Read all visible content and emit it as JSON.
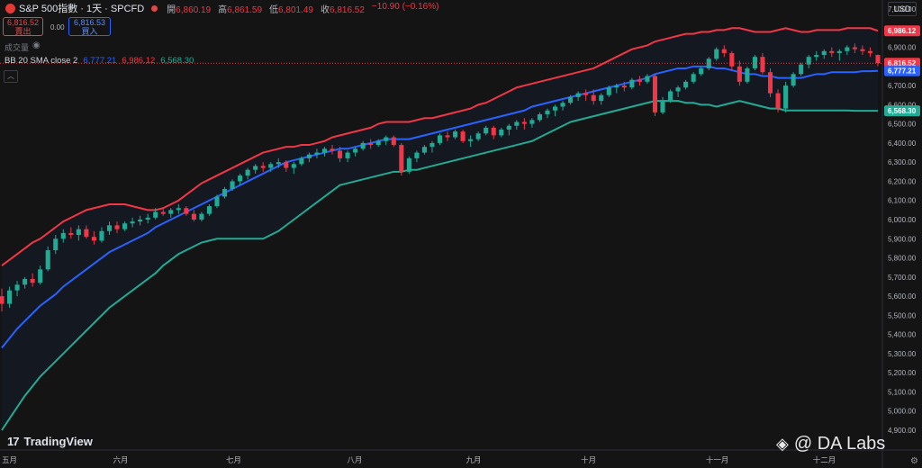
{
  "header": {
    "symbol_title": "S&P 500指數 · 1天 · SPCFD",
    "ohlc": [
      {
        "k": "開",
        "v": "6,860.19"
      },
      {
        "k": "高",
        "v": "6,861.59"
      },
      {
        "k": "低",
        "v": "6,801.49"
      },
      {
        "k": "收",
        "v": "6,816.52"
      }
    ],
    "change": "−10.90 (−0.16%)",
    "currency": "USD"
  },
  "trade": {
    "sell_price": "6,816.52",
    "sell_label": "賣出",
    "spread": "0.00",
    "buy_price": "6,816.53",
    "buy_label": "買入"
  },
  "indicators": {
    "volume_label": "成交量",
    "bb_name": "BB 20 SMA close 2",
    "bb_basis": "6,777.21",
    "bb_upper": "6,986.12",
    "bb_lower": "6,568.30"
  },
  "branding": {
    "tv_logo": "TradingView",
    "watermark": "@ DA Labs"
  },
  "colors": {
    "up": "#22ab94",
    "down": "#f23645",
    "basis": "#2962ff",
    "upper": "#f23645",
    "lower": "#22ab94",
    "price_tag": "#f23645"
  },
  "chart_data": {
    "type": "candlestick",
    "ylim": [
      4900,
      7100
    ],
    "y_ticks": [
      4900,
      5000,
      5100,
      5200,
      5300,
      5400,
      5500,
      5600,
      5700,
      5800,
      5900,
      6000,
      6100,
      6200,
      6300,
      6400,
      6500,
      6600,
      6700,
      6800,
      6900,
      7000,
      7100
    ],
    "y_tick_labels": [
      "4,900.00",
      "5,000.00",
      "5,100.00",
      "5,200.00",
      "5,300.00",
      "5,400.00",
      "5,500.00",
      "5,600.00",
      "5,700.00",
      "5,800.00",
      "5,900.00",
      "6,000.00",
      "6,100.00",
      "6,200.00",
      "6,300.00",
      "6,400.00",
      "6,500.00",
      "6,600.00",
      "6,700.00",
      "6,800.00",
      "6,900.00",
      "7,000.00",
      "7,100.00"
    ],
    "x_labels": [
      {
        "label": "五月",
        "pos": 0.0
      },
      {
        "label": "六月",
        "pos": 0.1357
      },
      {
        "label": "七月",
        "pos": 0.2647
      },
      {
        "label": "八月",
        "pos": 0.4027
      },
      {
        "label": "九月",
        "pos": 0.5385
      },
      {
        "label": "十月",
        "pos": 0.6697
      },
      {
        "label": "十一月",
        "pos": 0.8167
      },
      {
        "label": "十二月",
        "pos": 0.9389
      }
    ],
    "candles": [
      [
        5600,
        5640,
        5520,
        5560
      ],
      [
        5560,
        5650,
        5540,
        5630
      ],
      [
        5630,
        5680,
        5600,
        5660
      ],
      [
        5660,
        5700,
        5640,
        5690
      ],
      [
        5690,
        5720,
        5650,
        5670
      ],
      [
        5670,
        5760,
        5660,
        5740
      ],
      [
        5740,
        5860,
        5730,
        5840
      ],
      [
        5840,
        5920,
        5820,
        5900
      ],
      [
        5900,
        5950,
        5880,
        5930
      ],
      [
        5930,
        5960,
        5900,
        5920
      ],
      [
        5920,
        5970,
        5890,
        5950
      ],
      [
        5950,
        5970,
        5900,
        5910
      ],
      [
        5910,
        5940,
        5870,
        5890
      ],
      [
        5890,
        5960,
        5880,
        5940
      ],
      [
        5940,
        5990,
        5920,
        5970
      ],
      [
        5970,
        5990,
        5930,
        5950
      ],
      [
        5950,
        5990,
        5940,
        5980
      ],
      [
        5980,
        6010,
        5960,
        5990
      ],
      [
        5990,
        6020,
        5970,
        6000
      ],
      [
        6000,
        6030,
        5980,
        6010
      ],
      [
        6010,
        6060,
        6000,
        6040
      ],
      [
        6040,
        6060,
        6020,
        6030
      ],
      [
        6030,
        6060,
        6010,
        6050
      ],
      [
        6050,
        6080,
        6030,
        6060
      ],
      [
        6060,
        6070,
        6020,
        6030
      ],
      [
        6030,
        6050,
        5990,
        6000
      ],
      [
        6000,
        6040,
        5990,
        6030
      ],
      [
        6030,
        6080,
        6020,
        6070
      ],
      [
        6070,
        6130,
        6060,
        6120
      ],
      [
        6120,
        6170,
        6110,
        6160
      ],
      [
        6160,
        6210,
        6150,
        6200
      ],
      [
        6200,
        6240,
        6180,
        6230
      ],
      [
        6230,
        6270,
        6210,
        6260
      ],
      [
        6260,
        6290,
        6240,
        6280
      ],
      [
        6280,
        6300,
        6250,
        6270
      ],
      [
        6270,
        6300,
        6250,
        6290
      ],
      [
        6290,
        6320,
        6270,
        6300
      ],
      [
        6300,
        6310,
        6250,
        6270
      ],
      [
        6270,
        6300,
        6240,
        6290
      ],
      [
        6290,
        6330,
        6280,
        6320
      ],
      [
        6320,
        6350,
        6300,
        6340
      ],
      [
        6340,
        6370,
        6320,
        6350
      ],
      [
        6350,
        6380,
        6330,
        6370
      ],
      [
        6370,
        6390,
        6340,
        6360
      ],
      [
        6360,
        6380,
        6300,
        6320
      ],
      [
        6320,
        6360,
        6300,
        6350
      ],
      [
        6350,
        6380,
        6330,
        6370
      ],
      [
        6370,
        6410,
        6360,
        6400
      ],
      [
        6400,
        6420,
        6370,
        6390
      ],
      [
        6390,
        6420,
        6380,
        6410
      ],
      [
        6410,
        6440,
        6390,
        6430
      ],
      [
        6430,
        6440,
        6380,
        6390
      ],
      [
        6390,
        6400,
        6230,
        6250
      ],
      [
        6250,
        6330,
        6240,
        6320
      ],
      [
        6320,
        6360,
        6300,
        6350
      ],
      [
        6350,
        6390,
        6340,
        6380
      ],
      [
        6380,
        6410,
        6350,
        6400
      ],
      [
        6400,
        6450,
        6390,
        6440
      ],
      [
        6440,
        6460,
        6410,
        6430
      ],
      [
        6430,
        6470,
        6420,
        6460
      ],
      [
        6460,
        6470,
        6400,
        6410
      ],
      [
        6410,
        6440,
        6380,
        6420
      ],
      [
        6420,
        6460,
        6410,
        6450
      ],
      [
        6450,
        6490,
        6440,
        6480
      ],
      [
        6480,
        6490,
        6420,
        6440
      ],
      [
        6440,
        6480,
        6430,
        6470
      ],
      [
        6470,
        6500,
        6440,
        6490
      ],
      [
        6490,
        6520,
        6470,
        6510
      ],
      [
        6510,
        6530,
        6470,
        6500
      ],
      [
        6500,
        6530,
        6480,
        6520
      ],
      [
        6520,
        6560,
        6510,
        6550
      ],
      [
        6550,
        6580,
        6530,
        6570
      ],
      [
        6570,
        6600,
        6540,
        6590
      ],
      [
        6590,
        6620,
        6570,
        6610
      ],
      [
        6610,
        6650,
        6600,
        6640
      ],
      [
        6640,
        6670,
        6620,
        6660
      ],
      [
        6660,
        6680,
        6620,
        6650
      ],
      [
        6650,
        6680,
        6600,
        6620
      ],
      [
        6620,
        6660,
        6600,
        6650
      ],
      [
        6650,
        6700,
        6640,
        6690
      ],
      [
        6690,
        6710,
        6660,
        6700
      ],
      [
        6700,
        6720,
        6670,
        6690
      ],
      [
        6690,
        6740,
        6680,
        6730
      ],
      [
        6730,
        6750,
        6700,
        6720
      ],
      [
        6720,
        6760,
        6710,
        6750
      ],
      [
        6750,
        6760,
        6540,
        6560
      ],
      [
        6560,
        6640,
        6550,
        6620
      ],
      [
        6620,
        6680,
        6610,
        6670
      ],
      [
        6670,
        6700,
        6640,
        6690
      ],
      [
        6690,
        6730,
        6680,
        6720
      ],
      [
        6720,
        6770,
        6710,
        6760
      ],
      [
        6760,
        6800,
        6750,
        6790
      ],
      [
        6790,
        6850,
        6780,
        6840
      ],
      [
        6840,
        6900,
        6830,
        6890
      ],
      [
        6890,
        6910,
        6850,
        6870
      ],
      [
        6870,
        6880,
        6780,
        6800
      ],
      [
        6800,
        6830,
        6700,
        6720
      ],
      [
        6720,
        6800,
        6710,
        6790
      ],
      [
        6790,
        6860,
        6780,
        6850
      ],
      [
        6850,
        6870,
        6760,
        6770
      ],
      [
        6770,
        6790,
        6640,
        6660
      ],
      [
        6660,
        6680,
        6560,
        6580
      ],
      [
        6580,
        6720,
        6560,
        6700
      ],
      [
        6700,
        6770,
        6690,
        6760
      ],
      [
        6760,
        6820,
        6750,
        6810
      ],
      [
        6810,
        6860,
        6790,
        6850
      ],
      [
        6850,
        6880,
        6830,
        6860
      ],
      [
        6860,
        6890,
        6840,
        6880
      ],
      [
        6880,
        6900,
        6850,
        6870
      ],
      [
        6870,
        6890,
        6830,
        6880
      ],
      [
        6880,
        6910,
        6860,
        6900
      ],
      [
        6900,
        6920,
        6870,
        6890
      ],
      [
        6890,
        6910,
        6860,
        6880
      ],
      [
        6880,
        6900,
        6850,
        6870
      ],
      [
        6860,
        6862,
        6801,
        6817
      ]
    ],
    "bb_upper": [
      5760,
      5790,
      5820,
      5850,
      5880,
      5900,
      5930,
      5960,
      5990,
      6010,
      6030,
      6050,
      6060,
      6070,
      6080,
      6080,
      6080,
      6070,
      6060,
      6050,
      6050,
      6060,
      6080,
      6100,
      6130,
      6160,
      6190,
      6210,
      6230,
      6250,
      6270,
      6290,
      6310,
      6330,
      6350,
      6360,
      6370,
      6380,
      6380,
      6390,
      6390,
      6400,
      6410,
      6430,
      6440,
      6450,
      6460,
      6470,
      6480,
      6500,
      6510,
      6510,
      6510,
      6510,
      6520,
      6530,
      6530,
      6540,
      6550,
      6560,
      6570,
      6580,
      6600,
      6610,
      6630,
      6650,
      6670,
      6690,
      6700,
      6710,
      6720,
      6730,
      6740,
      6750,
      6760,
      6770,
      6780,
      6790,
      6810,
      6830,
      6850,
      6870,
      6890,
      6900,
      6910,
      6930,
      6940,
      6950,
      6960,
      6970,
      6970,
      6980,
      6980,
      6990,
      6990,
      7000,
      7000,
      6990,
      6980,
      6980,
      6980,
      6990,
      7000,
      6990,
      6980,
      6980,
      6990,
      6990,
      6990,
      6990,
      7000,
      7000,
      7000,
      7000,
      6986
    ],
    "bb_basis": [
      5330,
      5380,
      5430,
      5470,
      5510,
      5550,
      5580,
      5610,
      5650,
      5680,
      5710,
      5740,
      5770,
      5800,
      5830,
      5850,
      5870,
      5890,
      5910,
      5930,
      5960,
      5980,
      6000,
      6020,
      6040,
      6060,
      6080,
      6100,
      6120,
      6140,
      6160,
      6180,
      6200,
      6220,
      6240,
      6260,
      6280,
      6300,
      6310,
      6320,
      6330,
      6340,
      6350,
      6360,
      6370,
      6370,
      6380,
      6390,
      6400,
      6410,
      6420,
      6420,
      6420,
      6420,
      6430,
      6440,
      6450,
      6460,
      6470,
      6480,
      6490,
      6500,
      6510,
      6520,
      6530,
      6540,
      6550,
      6560,
      6570,
      6590,
      6600,
      6610,
      6620,
      6630,
      6640,
      6650,
      6660,
      6670,
      6680,
      6690,
      6700,
      6710,
      6720,
      6730,
      6740,
      6760,
      6770,
      6780,
      6790,
      6790,
      6800,
      6800,
      6800,
      6790,
      6790,
      6780,
      6770,
      6760,
      6760,
      6750,
      6750,
      6740,
      6740,
      6740,
      6740,
      6750,
      6760,
      6760,
      6770,
      6770,
      6770,
      6770,
      6775,
      6775,
      6777
    ],
    "bb_lower": [
      4900,
      4960,
      5020,
      5080,
      5130,
      5180,
      5220,
      5260,
      5300,
      5340,
      5380,
      5420,
      5460,
      5500,
      5540,
      5570,
      5600,
      5630,
      5660,
      5690,
      5720,
      5760,
      5790,
      5820,
      5840,
      5860,
      5880,
      5890,
      5900,
      5900,
      5900,
      5900,
      5900,
      5900,
      5900,
      5920,
      5940,
      5970,
      6000,
      6030,
      6060,
      6090,
      6120,
      6150,
      6180,
      6190,
      6200,
      6210,
      6220,
      6230,
      6240,
      6250,
      6250,
      6260,
      6260,
      6270,
      6280,
      6290,
      6300,
      6310,
      6320,
      6330,
      6340,
      6350,
      6360,
      6370,
      6380,
      6390,
      6400,
      6410,
      6430,
      6450,
      6470,
      6490,
      6510,
      6520,
      6530,
      6540,
      6550,
      6560,
      6570,
      6580,
      6590,
      6600,
      6610,
      6620,
      6620,
      6620,
      6620,
      6610,
      6610,
      6600,
      6600,
      6590,
      6600,
      6610,
      6620,
      6610,
      6600,
      6590,
      6580,
      6580,
      6570,
      6570,
      6570,
      6570,
      6570,
      6570,
      6570,
      6570,
      6570,
      6568,
      6568,
      6568,
      6568
    ]
  }
}
